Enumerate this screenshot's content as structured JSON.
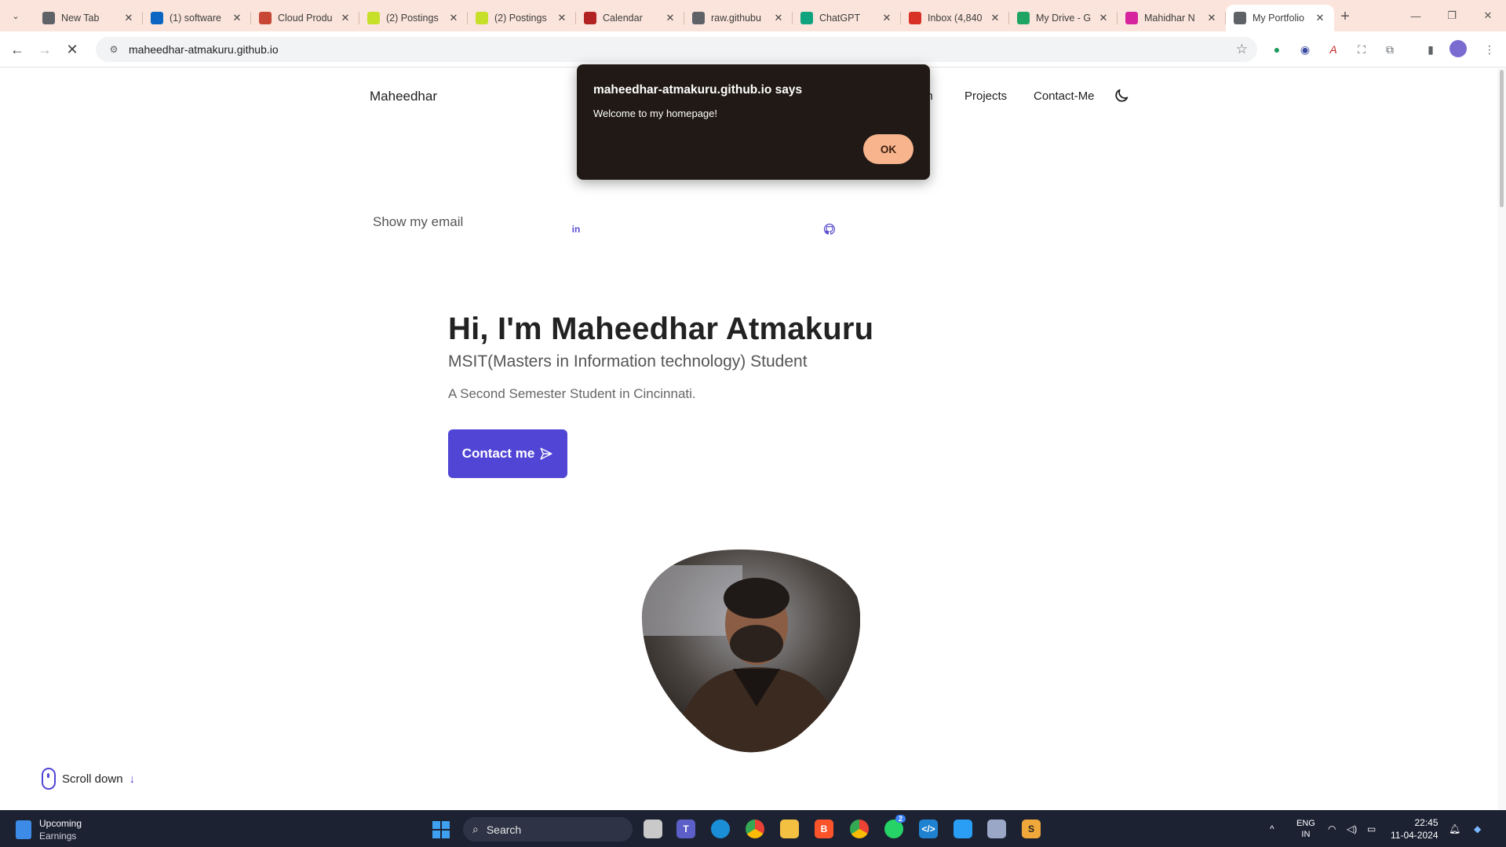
{
  "browser": {
    "tabs": [
      {
        "title": "New Tab",
        "favicon": "chrome-icon",
        "color": "#5f6368"
      },
      {
        "title": "(1) software",
        "favicon": "linkedin-icon",
        "color": "#0a66c2"
      },
      {
        "title": "Cloud Produ",
        "favicon": "oracle-icon",
        "color": "#c74634"
      },
      {
        "title": "(2) Postings",
        "favicon": "handshake-icon",
        "color": "#c6e02a"
      },
      {
        "title": "(2) Postings",
        "favicon": "handshake-icon",
        "color": "#c6e02a"
      },
      {
        "title": "Calendar",
        "favicon": "calendar-icon",
        "color": "#b22222"
      },
      {
        "title": "raw.githubu",
        "favicon": "globe-icon",
        "color": "#5f6368"
      },
      {
        "title": "ChatGPT",
        "favicon": "chatgpt-icon",
        "color": "#10a37f"
      },
      {
        "title": "Inbox (4,840",
        "favicon": "gmail-icon",
        "color": "#d93025"
      },
      {
        "title": "My Drive - G",
        "favicon": "drive-icon",
        "color": "#1fa463"
      },
      {
        "title": "Mahidhar N",
        "favicon": "instagram-icon",
        "color": "#d6249f"
      },
      {
        "title": "My Portfolio",
        "favicon": "loading-icon",
        "color": "#5f6368",
        "active": true
      }
    ],
    "url": "maheedhar-atmakuru.github.io"
  },
  "site": {
    "brand": "Maheedhar",
    "nav_partial": "on",
    "nav_projects": "Projects",
    "nav_contact": "Contact-Me",
    "show_email": "Show my email",
    "hero_title": "Hi, I'm Maheedhar Atmakuru",
    "hero_subtitle": "MSIT(Masters in Information technology) Student",
    "hero_desc": "A Second Semester Student in Cincinnati.",
    "contact_btn": "Contact me",
    "scroll_down": "Scroll down",
    "accent": "#5145d6"
  },
  "dialog": {
    "title": "maheedhar-atmakuru.github.io says",
    "message": "Welcome to my homepage!",
    "ok": "OK"
  },
  "taskbar": {
    "weather_line1": "Upcoming",
    "weather_line2": "Earnings",
    "search": "Search",
    "lang1": "ENG",
    "lang2": "IN",
    "time": "22:45",
    "date": "11-04-2024",
    "whatsapp_badge": "2"
  }
}
